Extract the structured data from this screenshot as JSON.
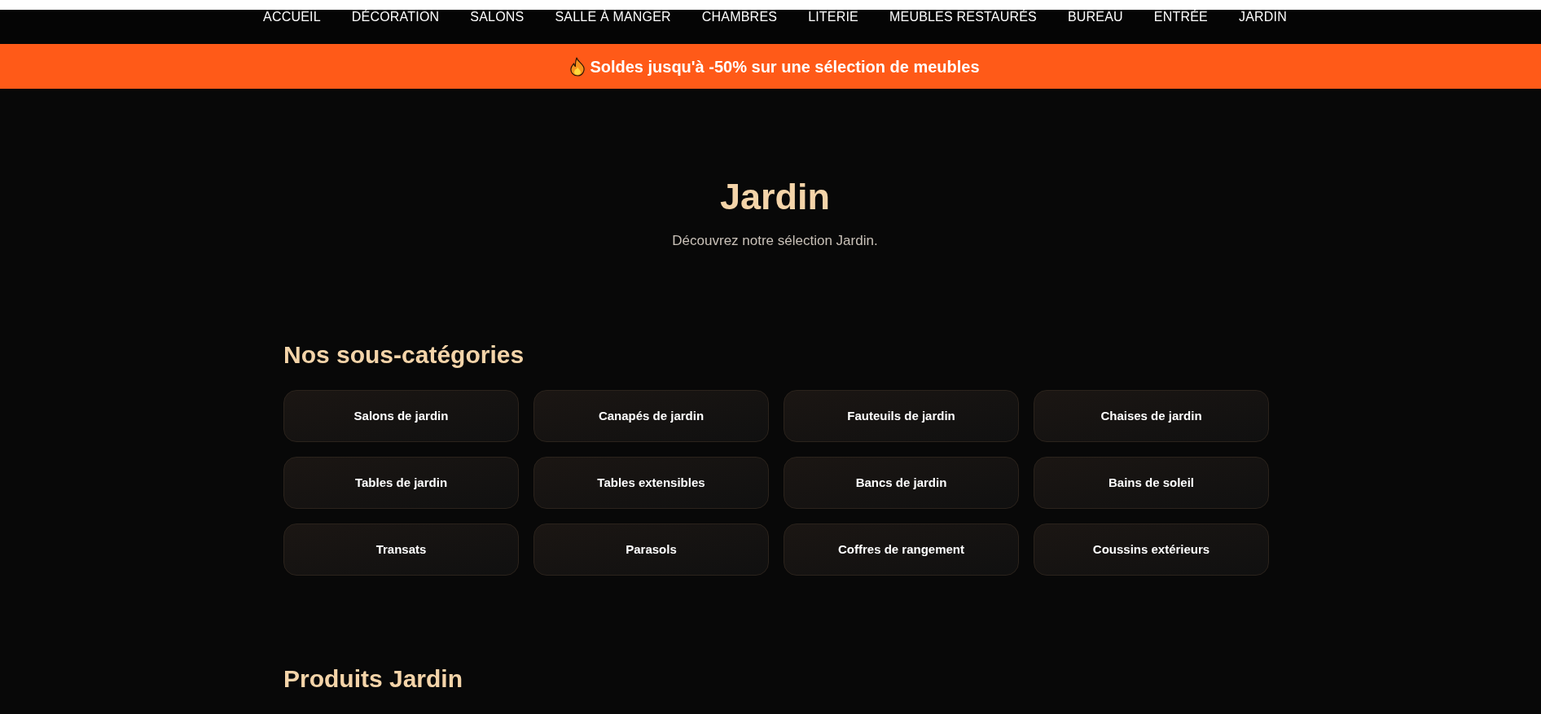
{
  "nav": {
    "items": [
      "ACCUEIL",
      "DÉCORATION",
      "SALONS",
      "SALLE À MANGER",
      "CHAMBRES",
      "LITERIE",
      "MEUBLES RESTAURÉS",
      "BUREAU",
      "ENTRÉE",
      "JARDIN"
    ]
  },
  "promo_banner": {
    "text": "Soldes jusqu'à -50% sur une sélection de meubles"
  },
  "hero": {
    "title": "Jardin",
    "subtitle": "Découvrez notre sélection Jardin."
  },
  "subcategories": {
    "heading": "Nos sous-catégories",
    "items": [
      "Salons de jardin",
      "Canapés de jardin",
      "Fauteuils de jardin",
      "Chaises de jardin",
      "Tables de jardin",
      "Tables extensibles",
      "Bancs de jardin",
      "Bains de soleil",
      "Transats",
      "Parasols",
      "Coffres de rangement",
      "Coussins extérieurs"
    ]
  },
  "products": {
    "heading": "Produits Jardin"
  }
}
